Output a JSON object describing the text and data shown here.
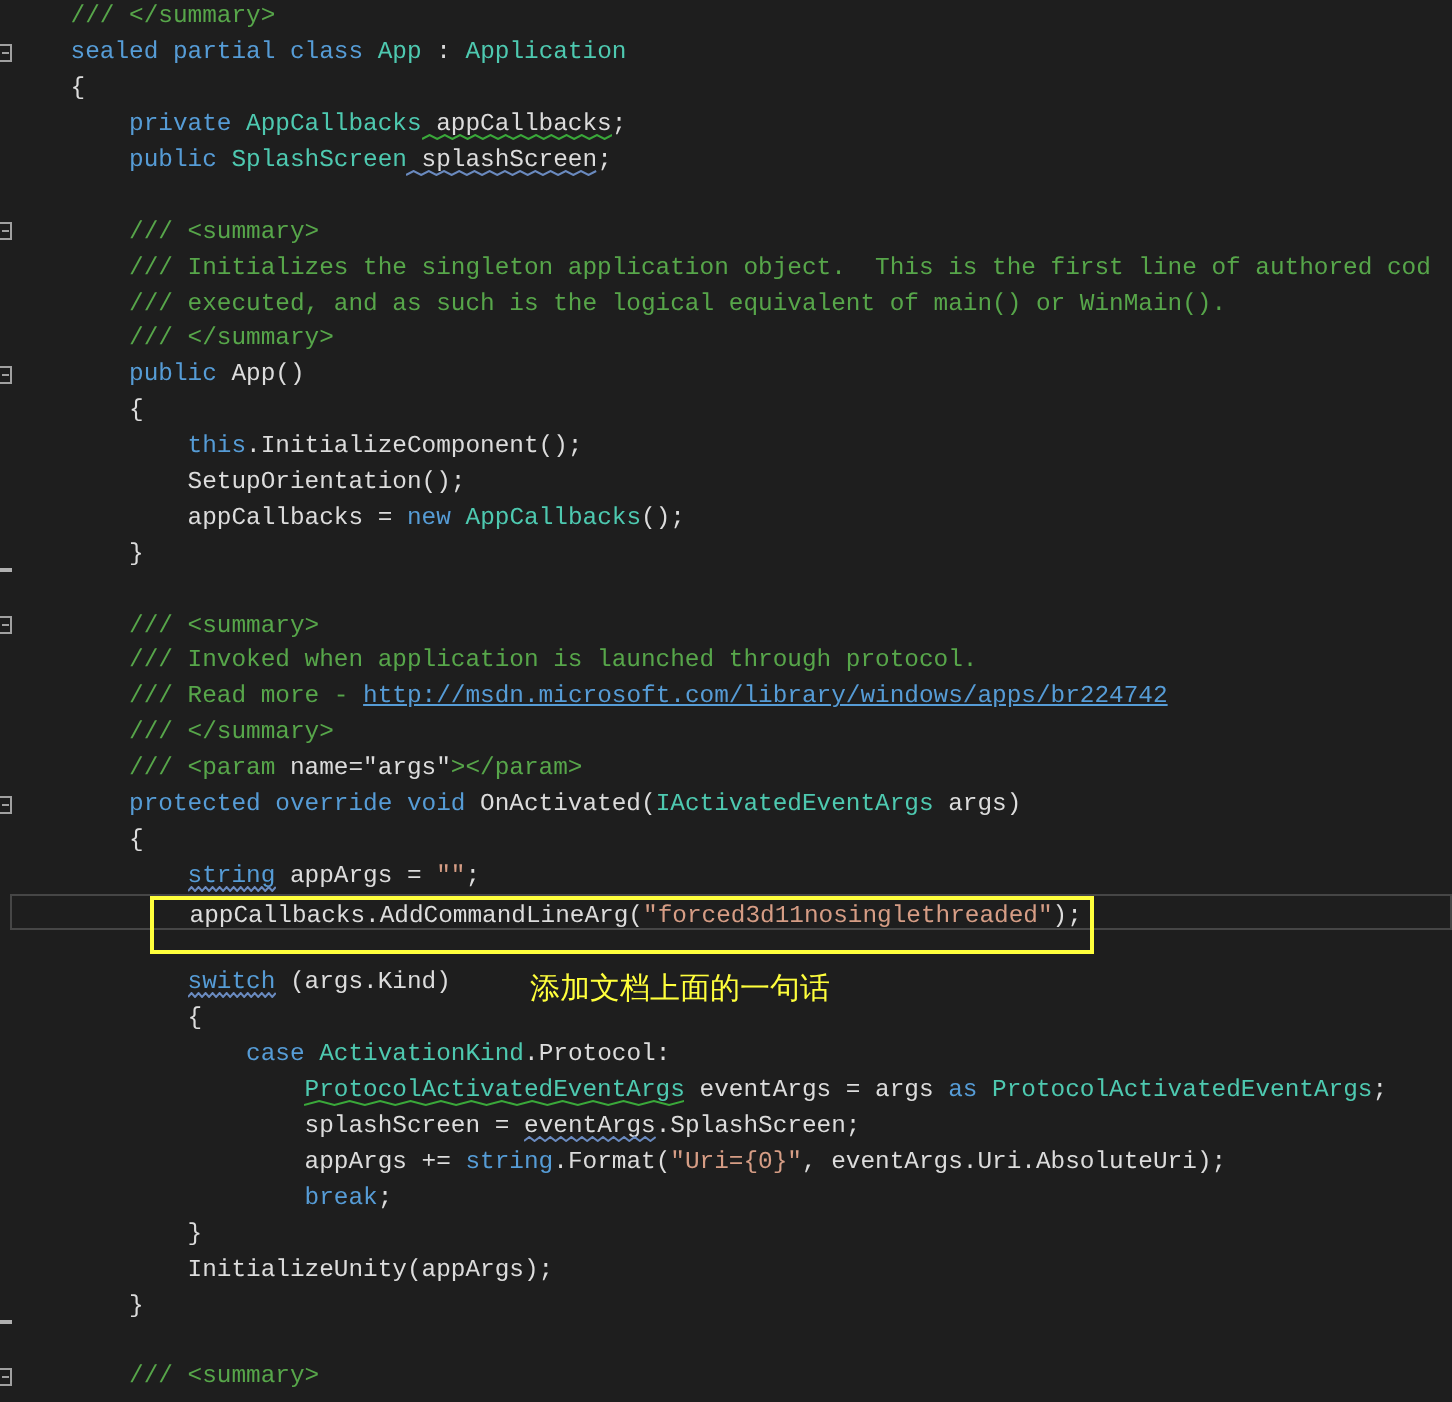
{
  "editor": {
    "lines": [
      {
        "fold_start": false,
        "fold_end": false,
        "tokens": [
          {
            "kind": "comment",
            "text": "    /// </summary>"
          }
        ]
      },
      {
        "fold_start": true,
        "fold_end": false,
        "tokens": [
          {
            "kind": "keyword",
            "text": "    sealed partial class "
          },
          {
            "kind": "type",
            "text": "App"
          },
          {
            "kind": "plain",
            "text": " : "
          },
          {
            "kind": "type",
            "text": "Application"
          }
        ]
      },
      {
        "fold_start": false,
        "fold_end": false,
        "tokens": [
          {
            "kind": "plain",
            "text": "    {"
          }
        ]
      },
      {
        "fold_start": false,
        "fold_end": false,
        "tokens": [
          {
            "kind": "keyword",
            "text": "        private "
          },
          {
            "kind": "type",
            "text": "AppCallbacks"
          },
          {
            "kind": "plain",
            "text": " appCallbacks",
            "squiggle": true,
            "color": "#3aa83a"
          },
          {
            "kind": "plain",
            "text": ";"
          }
        ]
      },
      {
        "fold_start": false,
        "fold_end": false,
        "tokens": [
          {
            "kind": "keyword",
            "text": "        public "
          },
          {
            "kind": "type",
            "text": "SplashScreen"
          },
          {
            "kind": "plain",
            "text": " splashScreen",
            "squiggle": true,
            "color": "#6a8abf"
          },
          {
            "kind": "plain",
            "text": ";"
          }
        ]
      },
      {
        "fold_start": false,
        "fold_end": false
      },
      {
        "fold_start": true,
        "fold_end": false,
        "tokens": [
          {
            "kind": "comment",
            "text": "        /// <summary>"
          }
        ]
      },
      {
        "fold_start": false,
        "fold_end": false,
        "tokens": [
          {
            "kind": "comment",
            "text": "        /// Initializes the singleton application object.  This is the first line of authored cod"
          }
        ]
      },
      {
        "fold_start": false,
        "fold_end": false,
        "tokens": [
          {
            "kind": "comment",
            "text": "        /// executed, and as such is the logical equivalent of main() or WinMain()."
          }
        ]
      },
      {
        "fold_start": false,
        "fold_end": false,
        "tokens": [
          {
            "kind": "comment",
            "text": "        /// </summary>"
          }
        ]
      },
      {
        "fold_start": true,
        "fold_end": false,
        "tokens": [
          {
            "kind": "keyword",
            "text": "        public "
          },
          {
            "kind": "plain",
            "text": "App()"
          }
        ]
      },
      {
        "fold_start": false,
        "fold_end": false,
        "tokens": [
          {
            "kind": "plain",
            "text": "        {"
          }
        ]
      },
      {
        "fold_start": false,
        "fold_end": false,
        "tokens": [
          {
            "kind": "keyword",
            "text": "            this"
          },
          {
            "kind": "plain",
            "text": ".InitializeComponent();"
          }
        ]
      },
      {
        "fold_start": false,
        "fold_end": false,
        "tokens": [
          {
            "kind": "plain",
            "text": "            SetupOrientation();"
          }
        ]
      },
      {
        "fold_start": false,
        "fold_end": false,
        "tokens": [
          {
            "kind": "plain",
            "text": "            appCallbacks = "
          },
          {
            "kind": "keyword",
            "text": "new "
          },
          {
            "kind": "type",
            "text": "AppCallbacks"
          },
          {
            "kind": "plain",
            "text": "();"
          }
        ]
      },
      {
        "fold_start": false,
        "fold_end": true,
        "tokens": [
          {
            "kind": "plain",
            "text": "        }"
          }
        ]
      },
      {
        "fold_start": false,
        "fold_end": false
      },
      {
        "fold_start": true,
        "fold_end": false,
        "tokens": [
          {
            "kind": "comment",
            "text": "        /// <summary>"
          }
        ]
      },
      {
        "fold_start": false,
        "fold_end": false,
        "tokens": [
          {
            "kind": "comment",
            "text": "        /// Invoked when application is launched through protocol."
          }
        ]
      },
      {
        "fold_start": false,
        "fold_end": false,
        "tokens": [
          {
            "kind": "comment",
            "text": "        /// Read more - "
          },
          {
            "kind": "link",
            "text": "http://msdn.microsoft.com/library/windows/apps/br224742"
          }
        ]
      },
      {
        "fold_start": false,
        "fold_end": false,
        "tokens": [
          {
            "kind": "comment",
            "text": "        /// </summary>"
          }
        ]
      },
      {
        "fold_start": false,
        "fold_end": false,
        "tokens": [
          {
            "kind": "comment",
            "text": "        /// <param "
          },
          {
            "kind": "plain",
            "text": "name=\"args\""
          },
          {
            "kind": "comment",
            "text": "></param>"
          }
        ]
      },
      {
        "fold_start": true,
        "fold_end": false,
        "tokens": [
          {
            "kind": "keyword",
            "text": "        protected override void "
          },
          {
            "kind": "plain",
            "text": "OnActivated("
          },
          {
            "kind": "type",
            "text": "IActivatedEventArgs"
          },
          {
            "kind": "plain",
            "text": " args)"
          }
        ]
      },
      {
        "fold_start": false,
        "fold_end": false,
        "tokens": [
          {
            "kind": "plain",
            "text": "        {"
          }
        ]
      },
      {
        "fold_start": false,
        "fold_end": false,
        "tokens": [
          {
            "kind": "keyword",
            "text": "            string",
            "squiggle": true,
            "color": "#6a8abf"
          },
          {
            "kind": "plain",
            "text": " appArgs = "
          },
          {
            "kind": "string",
            "text": "\"\""
          },
          {
            "kind": "plain",
            "text": ";"
          }
        ]
      },
      {
        "fold_start": false,
        "fold_end": false,
        "current": true,
        "boxed": true,
        "tokens": [
          {
            "kind": "plain",
            "text": "            appCallbacks.AddCommandLineArg("
          },
          {
            "kind": "string",
            "text": "\"forced3d11nosinglethreaded\""
          },
          {
            "kind": "plain",
            "text": ");"
          }
        ]
      },
      {
        "fold_start": false,
        "fold_end": false
      },
      {
        "fold_start": false,
        "fold_end": false,
        "note": "添加文档上面的一句话",
        "tokens": [
          {
            "kind": "keyword",
            "text": "            switch",
            "squiggle": true,
            "color": "#6a8abf"
          },
          {
            "kind": "plain",
            "text": " (args.Kind)"
          }
        ]
      },
      {
        "fold_start": false,
        "fold_end": false,
        "tokens": [
          {
            "kind": "plain",
            "text": "            {"
          }
        ]
      },
      {
        "fold_start": false,
        "fold_end": false,
        "tokens": [
          {
            "kind": "keyword",
            "text": "                case "
          },
          {
            "kind": "type",
            "text": "ActivationKind"
          },
          {
            "kind": "plain",
            "text": ".Protocol:"
          }
        ]
      },
      {
        "fold_start": false,
        "fold_end": false,
        "tokens": [
          {
            "kind": "type",
            "text": "                    ProtocolActivatedEventArgs",
            "squiggle": true,
            "color": "#3aa83a"
          },
          {
            "kind": "plain",
            "text": " eventArgs = args "
          },
          {
            "kind": "keyword",
            "text": "as "
          },
          {
            "kind": "type",
            "text": "ProtocolActivatedEventArgs"
          },
          {
            "kind": "plain",
            "text": ";"
          }
        ]
      },
      {
        "fold_start": false,
        "fold_end": false,
        "tokens": [
          {
            "kind": "plain",
            "text": "                    splashScreen = "
          },
          {
            "kind": "plain",
            "text": "eventArgs",
            "squiggle": true,
            "color": "#6a8abf"
          },
          {
            "kind": "plain",
            "text": ".SplashScreen;"
          }
        ]
      },
      {
        "fold_start": false,
        "fold_end": false,
        "tokens": [
          {
            "kind": "plain",
            "text": "                    appArgs += "
          },
          {
            "kind": "keyword",
            "text": "string"
          },
          {
            "kind": "plain",
            "text": ".Format("
          },
          {
            "kind": "string",
            "text": "\"Uri={0}\""
          },
          {
            "kind": "plain",
            "text": ", eventArgs.Uri.AbsoluteUri);"
          }
        ]
      },
      {
        "fold_start": false,
        "fold_end": false,
        "tokens": [
          {
            "kind": "keyword",
            "text": "                    break"
          },
          {
            "kind": "plain",
            "text": ";"
          }
        ]
      },
      {
        "fold_start": false,
        "fold_end": false,
        "tokens": [
          {
            "kind": "plain",
            "text": "            }"
          }
        ]
      },
      {
        "fold_start": false,
        "fold_end": false,
        "tokens": [
          {
            "kind": "plain",
            "text": "            InitializeUnity(appArgs);"
          }
        ]
      },
      {
        "fold_start": false,
        "fold_end": true,
        "tokens": [
          {
            "kind": "plain",
            "text": "        }"
          }
        ]
      },
      {
        "fold_start": false,
        "fold_end": false
      },
      {
        "fold_start": true,
        "fold_end": false,
        "tokens": [
          {
            "kind": "comment",
            "text": "        /// <summary>"
          }
        ]
      }
    ]
  }
}
